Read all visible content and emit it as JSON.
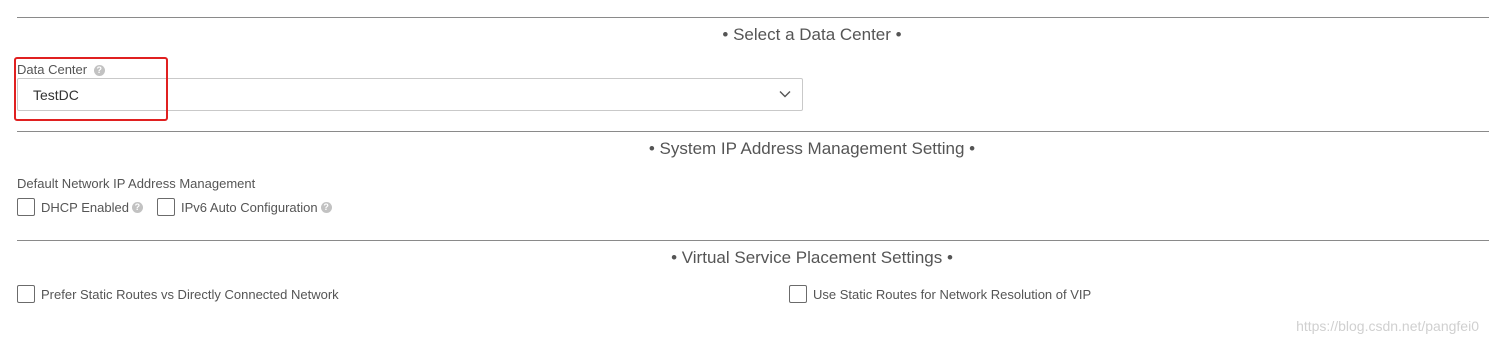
{
  "sections": {
    "data_center": {
      "title": "• Select a Data Center •"
    },
    "ipam": {
      "title": "• System IP Address Management Setting •"
    },
    "placement": {
      "title": "• Virtual Service Placement Settings •"
    }
  },
  "data_center_field": {
    "label": "Data Center",
    "help": "?",
    "value": "TestDC"
  },
  "ipam_field": {
    "label": "Default Network IP Address Management",
    "dhcp_label": "DHCP Enabled",
    "ipv6_label": "IPv6 Auto Configuration",
    "help": "?"
  },
  "placement_fields": {
    "prefer_static_label": "Prefer Static Routes vs Directly Connected Network",
    "use_static_label": "Use Static Routes for Network Resolution of VIP"
  },
  "watermark": "https://blog.csdn.net/pangfei0",
  "colors": {
    "highlight": "#e02020",
    "divider": "#8a8a8a",
    "text": "#555555"
  }
}
